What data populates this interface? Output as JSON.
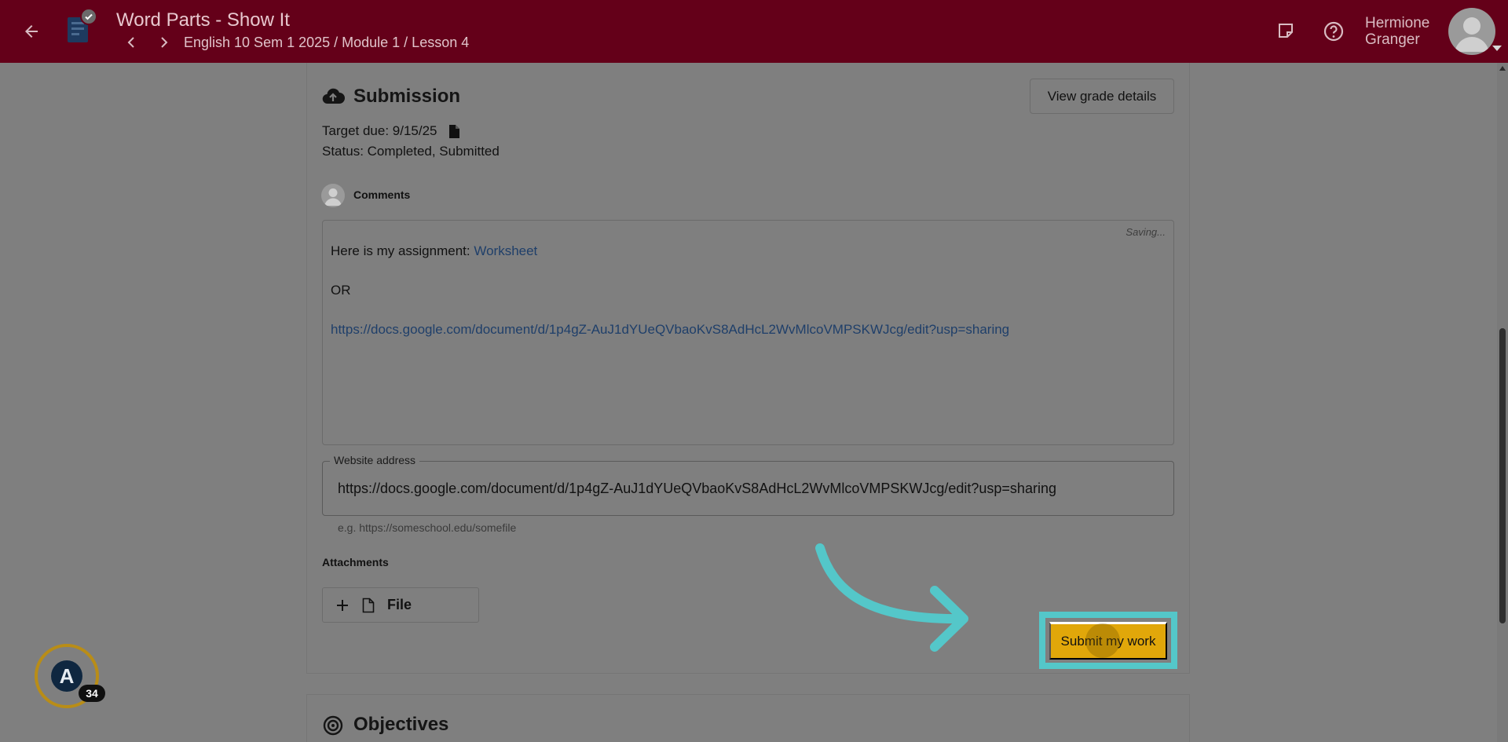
{
  "header": {
    "title": "Word Parts - Show It",
    "breadcrumb": "English 10 Sem 1 2025 / Module 1 / Lesson 4",
    "user_name_first": "Hermione",
    "user_name_last": "Granger"
  },
  "submission": {
    "title": "Submission",
    "view_grade_label": "View grade details",
    "target_due": "Target due: 9/15/25",
    "status": "Status: Completed, Submitted"
  },
  "comments": {
    "label": "Comments",
    "saving_text": "Saving...",
    "line1_prefix": "Here is my assignment: ",
    "line1_link": "Worksheet",
    "line2": "OR",
    "line3_link": "https://docs.google.com/document/d/1p4gZ-AuJ1dYUeQVbaoKvS8AdHcL2WvMlcoVMPSKWJcg/edit?usp=sharing"
  },
  "website": {
    "label": "Website address",
    "value": "https://docs.google.com/document/d/1p4gZ-AuJ1dYUeQVbaoKvS8AdHcL2WvMlcoVMPSKWJcg/edit?usp=sharing",
    "hint": "e.g. https://someschool.edu/somefile"
  },
  "attachments": {
    "label": "Attachments",
    "file_button_label": "File"
  },
  "submit_label": "Submit my work",
  "objectives": {
    "title": "Objectives"
  },
  "badge": {
    "count": "34",
    "letter": "A"
  },
  "colors": {
    "header_bg": "#640019",
    "submit_bg": "#e1a70a",
    "highlight": "#54c7c9",
    "overlay_bg": "#7f7f7f",
    "link": "#1f3f6a"
  }
}
